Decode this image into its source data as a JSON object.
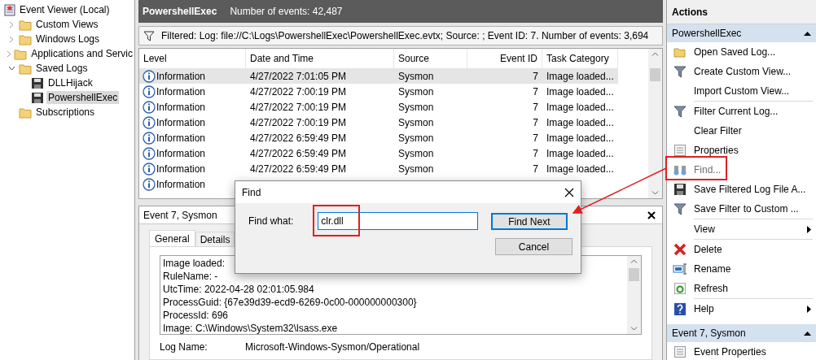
{
  "tree": [
    {
      "label": "Event Viewer (Local)",
      "selected": false,
      "children": [
        {
          "label": "Custom Views",
          "expanded": false,
          "selected": false
        },
        {
          "label": "Windows Logs",
          "expanded": false,
          "selected": false
        },
        {
          "label": "Applications and Servic",
          "expanded": false,
          "selected": false
        },
        {
          "label": "Saved Logs",
          "expanded": true,
          "selected": false,
          "children": [
            {
              "label": "DLLHijack",
              "selected": false
            },
            {
              "label": "PowershellExec",
              "selected": true
            }
          ]
        },
        {
          "label": "Subscriptions",
          "selected": false
        }
      ]
    }
  ],
  "log_header": {
    "title": "PowershellExec",
    "count": "Number of events: 42,487"
  },
  "filter_bar": "Filtered: Log: file://C:\\Logs\\PowershellExec\\PowershellExec.evtx; Source: ; Event ID: 7. Number of events: 3,694",
  "table": {
    "columns": [
      "Level",
      "Date and Time",
      "Source",
      "Event ID",
      "Task Category"
    ],
    "rows": [
      {
        "selected": true,
        "cells": [
          "Information",
          "4/27/2022 7:01:05 PM",
          "Sysmon",
          "7",
          "Image loaded..."
        ]
      },
      {
        "selected": false,
        "cells": [
          "Information",
          "4/27/2022 7:00:19 PM",
          "Sysmon",
          "7",
          "Image loaded..."
        ]
      },
      {
        "selected": false,
        "cells": [
          "Information",
          "4/27/2022 7:00:19 PM",
          "Sysmon",
          "7",
          "Image loaded..."
        ]
      },
      {
        "selected": false,
        "cells": [
          "Information",
          "4/27/2022 7:00:19 PM",
          "Sysmon",
          "7",
          "Image loaded..."
        ]
      },
      {
        "selected": false,
        "cells": [
          "Information",
          "4/27/2022 6:59:49 PM",
          "Sysmon",
          "7",
          "Image loaded..."
        ]
      },
      {
        "selected": false,
        "cells": [
          "Information",
          "4/27/2022 6:59:49 PM",
          "Sysmon",
          "7",
          "Image loaded..."
        ]
      },
      {
        "selected": false,
        "cells": [
          "Information",
          "4/27/2022 6:59:49 PM",
          "Sysmon",
          "7",
          "Image loaded..."
        ]
      },
      {
        "selected": false,
        "cells": [
          "Information"
        ]
      }
    ]
  },
  "event_pane": {
    "title": "Event 7, Sysmon",
    "tabs": [
      {
        "label": "General",
        "selected": true
      },
      {
        "label": "Details",
        "selected": false
      }
    ],
    "text_lines": [
      "Image loaded:",
      "RuleName: -",
      "UtcTime: 2022-04-28 02:01:05.984",
      "ProcessGuid: {67e39d39-ecd9-6269-0c00-000000000300}",
      "ProcessId: 696",
      "Image: C:\\Windows\\System32\\lsass.exe"
    ],
    "field": {
      "label": "Log Name:",
      "value": "Microsoft-Windows-Sysmon/Operational"
    }
  },
  "find_dialog": {
    "title": "Find",
    "label": "Find what:",
    "value": "clr.dll",
    "buttons": [
      {
        "label": "Find Next",
        "default": true
      },
      {
        "label": "Cancel",
        "default": false
      }
    ]
  },
  "actions": {
    "title": "Actions",
    "sections": [
      {
        "title": "PowershellExec",
        "items": [
          {
            "label": "Open Saved Log...",
            "disabled": false,
            "submenu": false,
            "separator_after": false
          },
          {
            "label": "Create Custom View...",
            "disabled": false,
            "submenu": false,
            "separator_after": false
          },
          {
            "label": "Import Custom View...",
            "disabled": false,
            "submenu": false,
            "separator_after": true
          },
          {
            "label": "Filter Current Log...",
            "disabled": false,
            "submenu": false,
            "separator_after": false
          },
          {
            "label": "Clear Filter",
            "disabled": false,
            "submenu": false,
            "separator_after": false
          },
          {
            "label": "Properties",
            "disabled": false,
            "submenu": false,
            "separator_after": false
          },
          {
            "label": "Find...",
            "disabled": true,
            "submenu": false,
            "separator_after": false
          },
          {
            "label": "Save Filtered Log File A...",
            "disabled": false,
            "submenu": false,
            "separator_after": false
          },
          {
            "label": "Save Filter to Custom ...",
            "disabled": false,
            "submenu": false,
            "separator_after": true
          },
          {
            "label": "View",
            "disabled": false,
            "submenu": true,
            "separator_after": true
          },
          {
            "label": "Delete",
            "disabled": false,
            "submenu": false,
            "separator_after": false
          },
          {
            "label": "Rename",
            "disabled": false,
            "submenu": false,
            "separator_after": false
          },
          {
            "label": "Refresh",
            "disabled": false,
            "submenu": false,
            "separator_after": true
          },
          {
            "label": "Help",
            "disabled": false,
            "submenu": true,
            "separator_after": false
          }
        ]
      },
      {
        "title": "Event 7, Sysmon",
        "items": [
          {
            "label": "Event Properties",
            "disabled": false,
            "submenu": false,
            "separator_after": false
          }
        ]
      }
    ]
  }
}
